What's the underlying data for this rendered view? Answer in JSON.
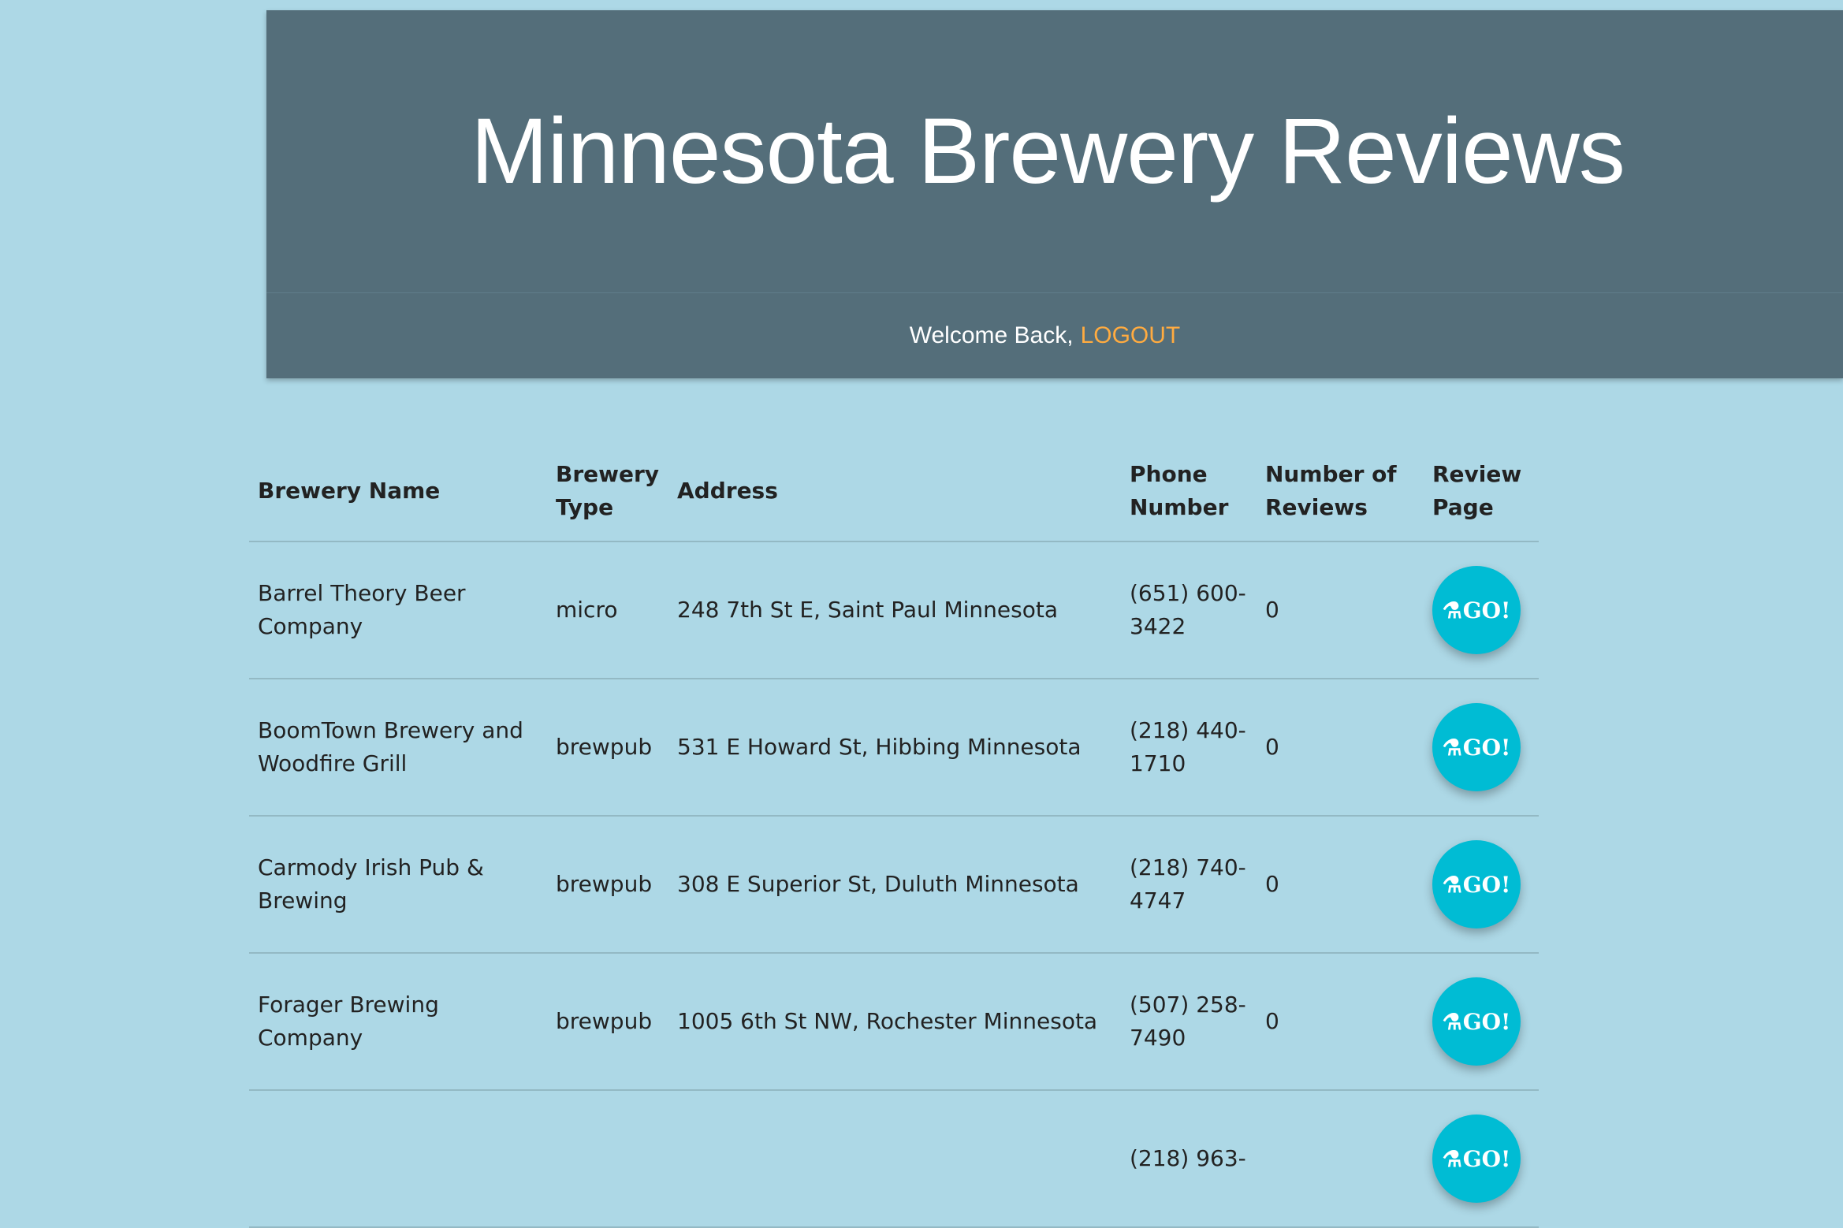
{
  "header": {
    "title": "Minnesota Brewery Reviews",
    "welcome_text": "Welcome Back,",
    "logout_label": "LOGOUT"
  },
  "table": {
    "columns": [
      "Brewery Name",
      "Brewery Type",
      "Address",
      "Phone Number",
      "Number of Reviews",
      "Review Page"
    ],
    "go_label": "GO!",
    "rows": [
      {
        "name": "Barrel Theory Beer Company",
        "type": "micro",
        "address": "248 7th St E, Saint Paul Minnesota",
        "phone": "(651) 600-3422",
        "reviews": "0"
      },
      {
        "name": "BoomTown Brewery and Woodfire Grill",
        "type": "brewpub",
        "address": "531 E Howard St, Hibbing Minnesota",
        "phone": "(218) 440-1710",
        "reviews": "0"
      },
      {
        "name": "Carmody Irish Pub & Brewing",
        "type": "brewpub",
        "address": "308 E Superior St, Duluth Minnesota",
        "phone": "(218) 740-4747",
        "reviews": "0"
      },
      {
        "name": "Forager Brewing Company",
        "type": "brewpub",
        "address": "1005 6th St NW, Rochester Minnesota",
        "phone": "(507) 258-7490",
        "reviews": "0"
      },
      {
        "name": "",
        "type": "",
        "address": "",
        "phone": "(218) 963-",
        "reviews": ""
      }
    ]
  },
  "colors": {
    "background": "#add8e6",
    "header": "#546e7a",
    "accent": "#ffab40",
    "button": "#00bcd4"
  },
  "icons": {
    "go_button_icon": "flask-icon"
  }
}
